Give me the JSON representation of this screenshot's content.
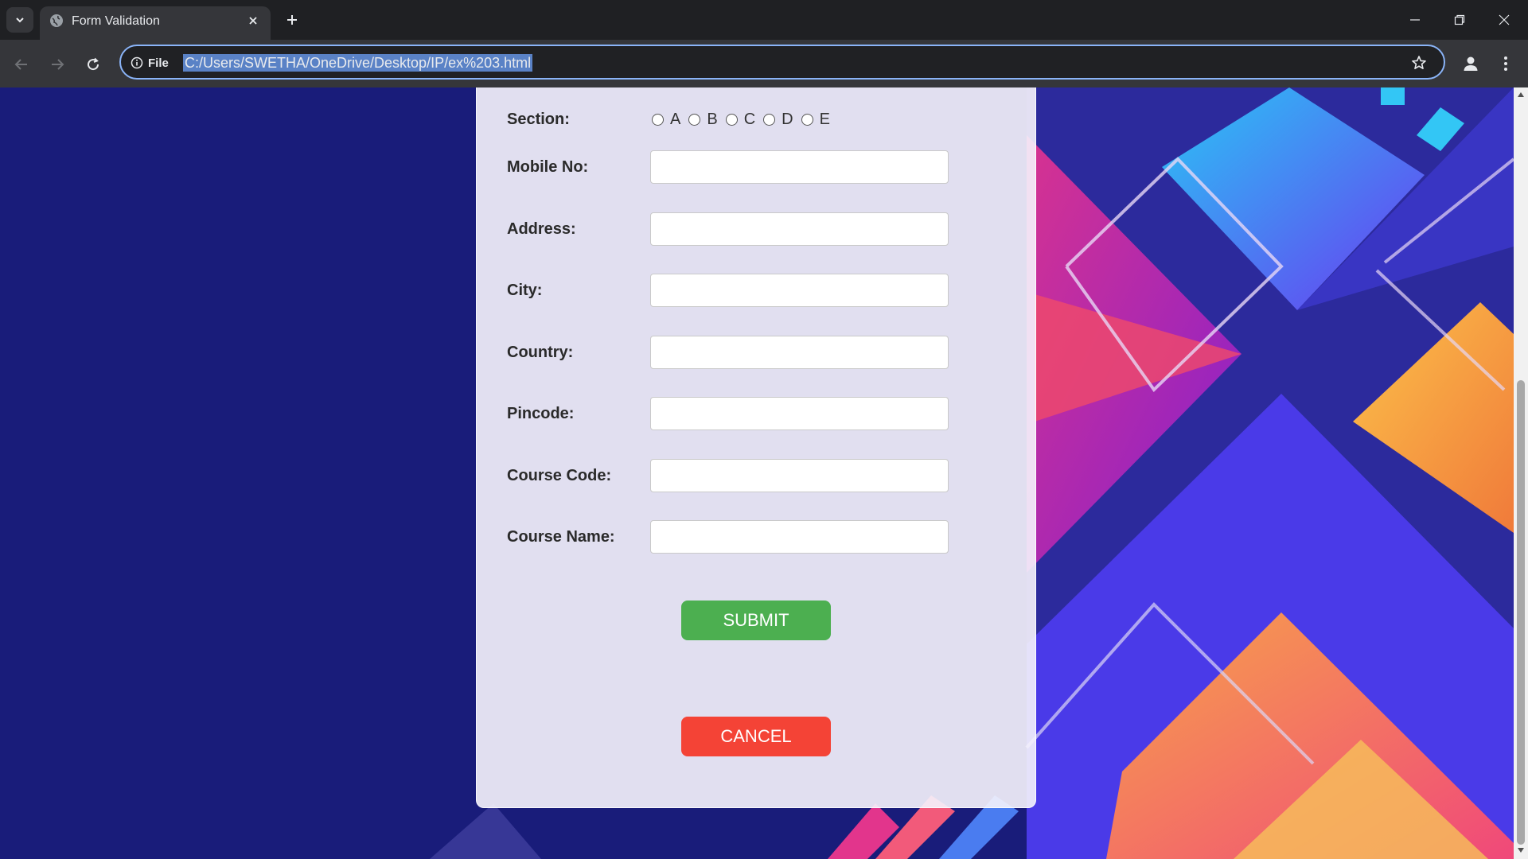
{
  "browser": {
    "tab_title": "Form Validation",
    "site_info_label": "File",
    "url": "C:/Users/SWETHA/OneDrive/Desktop/IP/ex%203.html"
  },
  "form": {
    "section": {
      "label": "Section:",
      "options": [
        "A",
        "B",
        "C",
        "D",
        "E"
      ]
    },
    "fields": {
      "mobile": {
        "label": "Mobile No:",
        "value": ""
      },
      "address": {
        "label": "Address:",
        "value": ""
      },
      "city": {
        "label": "City:",
        "value": ""
      },
      "country": {
        "label": "Country:",
        "value": ""
      },
      "pincode": {
        "label": "Pincode:",
        "value": ""
      },
      "course_code": {
        "label": "Course Code:",
        "value": ""
      },
      "course_name": {
        "label": "Course Name:",
        "value": ""
      }
    },
    "submit_label": "SUBMIT",
    "cancel_label": "CANCEL"
  },
  "colors": {
    "submit": "#4caf50",
    "cancel": "#f44336",
    "page_background": "#191c7a",
    "url_highlight": "#5a82c6"
  },
  "icons": {
    "tab_list": "chevron-down-icon",
    "favicon": "globe-icon",
    "tab_close": "close-icon",
    "new_tab": "plus-icon",
    "back": "arrow-left-icon",
    "forward": "arrow-right-icon",
    "reload": "reload-icon",
    "site_info": "info-icon",
    "bookmark": "star-icon",
    "profile": "person-icon",
    "menu": "kebab-menu-icon"
  }
}
